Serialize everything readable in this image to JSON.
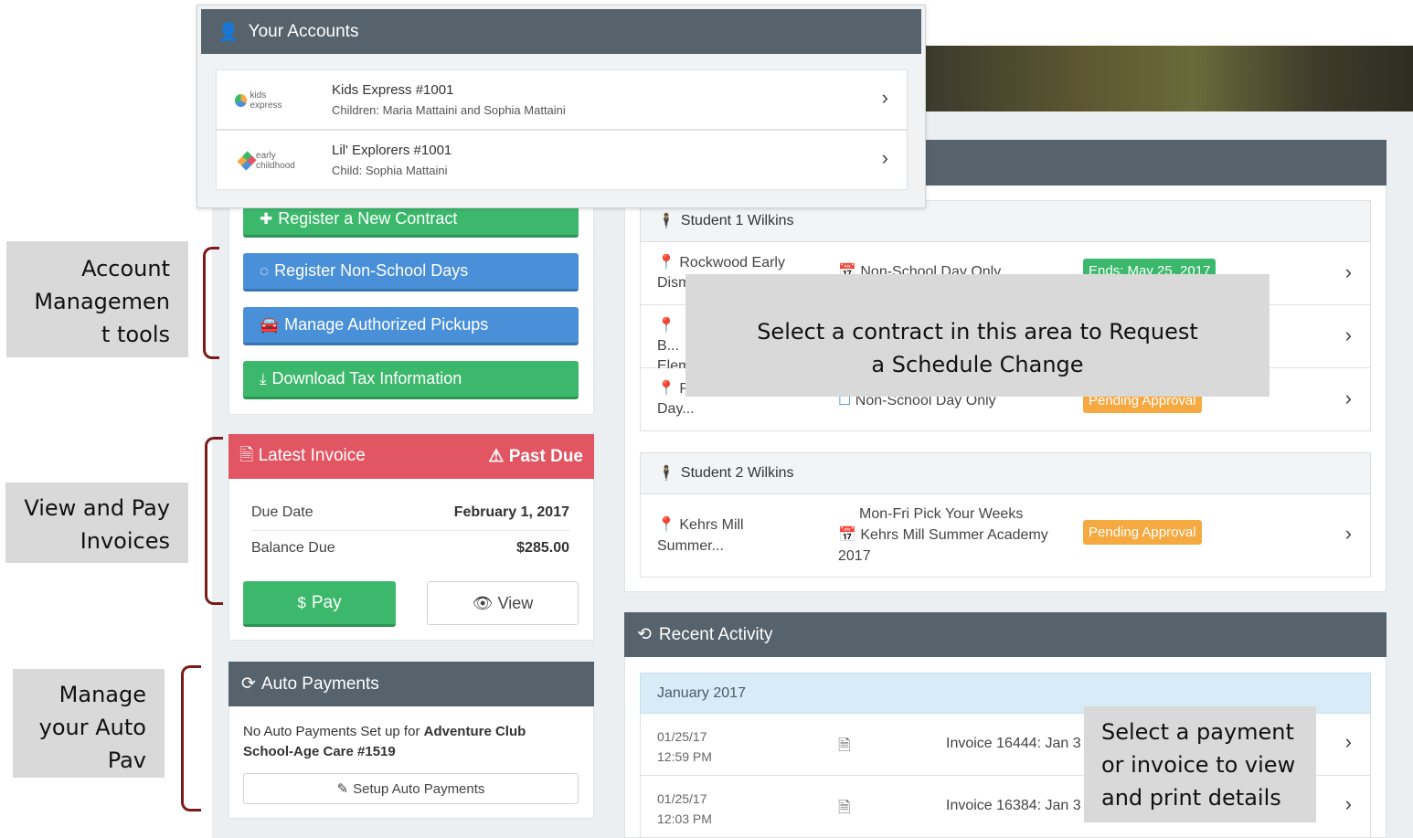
{
  "accounts": {
    "title": "Your Accounts",
    "items": [
      {
        "logo_text": "kids express",
        "name": "Kids Express #1001",
        "sub": "Children: Maria Mattaini and Sophia Mattaini"
      },
      {
        "logo_text": "early childhood",
        "name": "Lil' Explorers #1001",
        "sub": "Child: Sophia Mattaini"
      }
    ]
  },
  "tools": {
    "register_contract": "Register a New Contract",
    "register_nonschool": "Register Non-School Days",
    "manage_pickups": "Manage Authorized Pickups",
    "download_tax": "Download Tax Information"
  },
  "invoice": {
    "title": "Latest Invoice",
    "status": "Past Due",
    "due_date_label": "Due Date",
    "due_date_value": "February 1, 2017",
    "balance_label": "Balance Due",
    "balance_value": "$285.00",
    "pay_label": "Pay",
    "view_label": "View"
  },
  "auto_payments": {
    "title": "Auto Payments",
    "text_prefix": "No Auto Payments Set up for ",
    "text_bold": "Adventure Club School-Age Care #1519",
    "setup_label": "Setup Auto Payments"
  },
  "contracts": {
    "student1": "Student 1 Wilkins",
    "student1_rows": [
      {
        "location": "Rockwood Early Dism",
        "program": "Non-School Day Only",
        "badge": "Ends: May 25, 2017"
      },
      {
        "location": "B... Elem",
        "program": "",
        "badge": ""
      },
      {
        "location": "P... School Day...",
        "program": "Non-School Day Only",
        "badge": "Pending Approval"
      }
    ],
    "student2": "Student 2 Wilkins",
    "student2_rows": [
      {
        "location": "Kehrs Mill Summer...",
        "program_line1": "Mon-Fri Pick Your Weeks",
        "program_line2": "Kehrs Mill Summer Academy 2017",
        "badge": "Pending Approval"
      }
    ]
  },
  "activity": {
    "title": "Recent Activity",
    "month": "January 2017",
    "items": [
      {
        "date": "01/25/17",
        "time": "12:59 PM",
        "desc": "Invoice 16444: Jan 3"
      },
      {
        "date": "01/25/17",
        "time": "12:03 PM",
        "desc": "Invoice 16384: Jan 3"
      }
    ]
  },
  "annotations": {
    "account_mgmt_l1": "Account",
    "account_mgmt_l2": "Managemen",
    "account_mgmt_l3": "t tools",
    "view_pay_l1": "View and Pay",
    "view_pay_l2": "Invoices",
    "auto_l1": "Manage",
    "auto_l2": "your Auto",
    "auto_l3": "Pav",
    "contract_l1": "Select a contract in this area to Request",
    "contract_l2": "a Schedule Change",
    "payment_l1": "Select a payment",
    "payment_l2": "or invoice to view",
    "payment_l3": "and print details"
  },
  "colors": {
    "header": "#56626c",
    "green": "#3cb86c",
    "blue": "#4a90d9",
    "red": "#e25563",
    "orange": "#f5a940",
    "bracket": "#7b1a1a"
  }
}
